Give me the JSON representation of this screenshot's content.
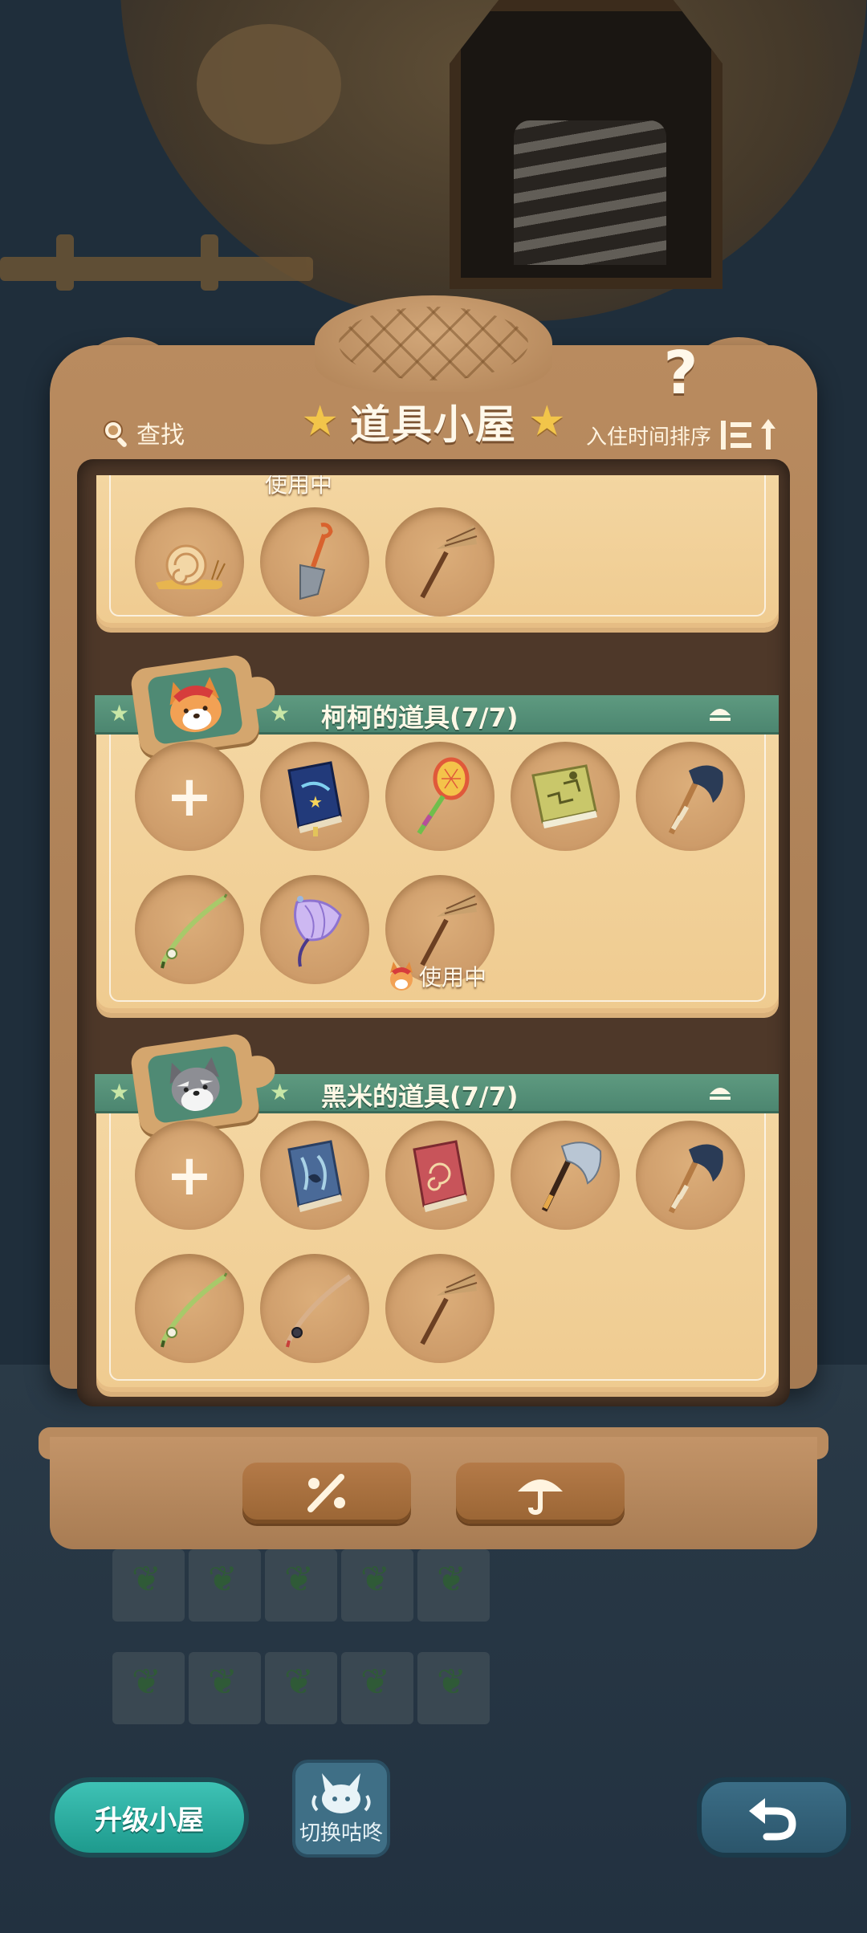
{
  "header": {
    "search_label": "查找",
    "title": "道具小屋",
    "help_symbol": "?",
    "sort_label": "入住时间排序"
  },
  "sections": [
    {
      "owner": "",
      "title": "",
      "items": [
        "snail-icon",
        "shovel-icon",
        "rake-icon"
      ],
      "in_use_partial": "使用中"
    },
    {
      "owner": "柯柯",
      "title": "柯柯的道具(7/7)",
      "pet": "corgi-avatar",
      "items": [
        "add-slot",
        "star-book-icon",
        "bug-net-icon",
        "map-book-icon",
        "axe-dark-icon",
        "fishing-rod-icon",
        "umbrella-icon",
        "rake-icon"
      ],
      "in_use_label": "使用中"
    },
    {
      "owner": "黑米",
      "title": "黑米的道具(7/7)",
      "pet": "schnauzer-avatar",
      "items": [
        "add-slot",
        "blue-book-icon",
        "red-book-icon",
        "axe-silver-icon",
        "axe-dark-icon",
        "fishing-rod-icon",
        "fishing-rod-brown-icon",
        "rake-icon"
      ]
    }
  ],
  "cabinet_buttons": [
    "percent-tag-icon",
    "umbrella-icon"
  ],
  "hud": {
    "upgrade_label": "升级小屋",
    "switch_label": "切换咕咚",
    "back_icon": "return-arrow-icon"
  },
  "colors": {
    "ribbon_green": "#4c8670",
    "panel_cream": "#f4d7a3",
    "wood": "#b98b5f",
    "teal_button": "#1e9a8d"
  }
}
